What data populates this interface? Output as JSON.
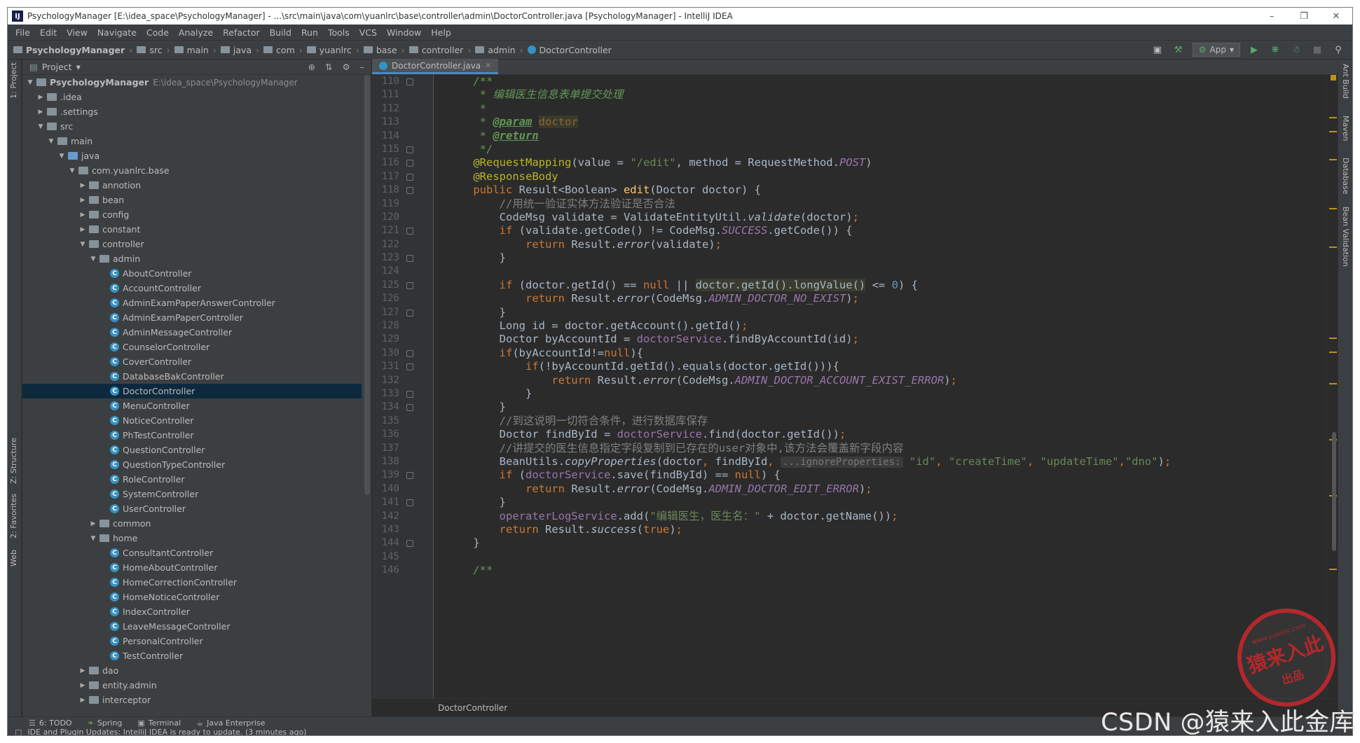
{
  "window": {
    "title": "PsychologyManager [E:\\idea_space\\PsychologyManager] - ...\\src\\main\\java\\com\\yuanlrc\\base\\controller\\admin\\DoctorController.java [PsychologyManager] - IntelliJ IDEA",
    "app_icon": "IJ",
    "controls": [
      "–",
      "❐",
      "✕"
    ]
  },
  "menu": [
    "File",
    "Edit",
    "View",
    "Navigate",
    "Code",
    "Analyze",
    "Refactor",
    "Build",
    "Run",
    "Tools",
    "VCS",
    "Window",
    "Help"
  ],
  "breadcrumbs": [
    "PsychologyManager",
    "src",
    "main",
    "java",
    "com",
    "yuanlrc",
    "base",
    "controller",
    "admin",
    "DoctorController"
  ],
  "run_config": "App",
  "project_panel": {
    "title": "Project",
    "tree": [
      {
        "label": "PsychologyManager",
        "path": "E:\\idea_space\\PsychologyManager",
        "depth": 0,
        "arrow": "down",
        "icon": "folder",
        "bold": true
      },
      {
        "label": ".idea",
        "depth": 1,
        "arrow": "right",
        "icon": "folder"
      },
      {
        "label": ".settings",
        "depth": 1,
        "arrow": "right",
        "icon": "folder"
      },
      {
        "label": "src",
        "depth": 1,
        "arrow": "down",
        "icon": "folder"
      },
      {
        "label": "main",
        "depth": 2,
        "arrow": "down",
        "icon": "folder"
      },
      {
        "label": "java",
        "depth": 3,
        "arrow": "down",
        "icon": "folder-blue"
      },
      {
        "label": "com.yuanlrc.base",
        "depth": 4,
        "arrow": "down",
        "icon": "folder"
      },
      {
        "label": "annotion",
        "depth": 5,
        "arrow": "right",
        "icon": "folder"
      },
      {
        "label": "bean",
        "depth": 5,
        "arrow": "right",
        "icon": "folder"
      },
      {
        "label": "config",
        "depth": 5,
        "arrow": "right",
        "icon": "folder"
      },
      {
        "label": "constant",
        "depth": 5,
        "arrow": "right",
        "icon": "folder"
      },
      {
        "label": "controller",
        "depth": 5,
        "arrow": "down",
        "icon": "folder"
      },
      {
        "label": "admin",
        "depth": 6,
        "arrow": "down",
        "icon": "folder"
      },
      {
        "label": "AboutController",
        "depth": 7,
        "icon": "class"
      },
      {
        "label": "AccountController",
        "depth": 7,
        "icon": "class"
      },
      {
        "label": "AdminExamPaperAnswerController",
        "depth": 7,
        "icon": "class"
      },
      {
        "label": "AdminExamPaperController",
        "depth": 7,
        "icon": "class"
      },
      {
        "label": "AdminMessageController",
        "depth": 7,
        "icon": "class"
      },
      {
        "label": "CounselorController",
        "depth": 7,
        "icon": "class"
      },
      {
        "label": "CoverController",
        "depth": 7,
        "icon": "class"
      },
      {
        "label": "DatabaseBakController",
        "depth": 7,
        "icon": "class"
      },
      {
        "label": "DoctorController",
        "depth": 7,
        "icon": "class",
        "selected": true
      },
      {
        "label": "MenuController",
        "depth": 7,
        "icon": "class"
      },
      {
        "label": "NoticeController",
        "depth": 7,
        "icon": "class"
      },
      {
        "label": "PhTestController",
        "depth": 7,
        "icon": "class"
      },
      {
        "label": "QuestionController",
        "depth": 7,
        "icon": "class"
      },
      {
        "label": "QuestionTypeController",
        "depth": 7,
        "icon": "class"
      },
      {
        "label": "RoleController",
        "depth": 7,
        "icon": "class"
      },
      {
        "label": "SystemController",
        "depth": 7,
        "icon": "class"
      },
      {
        "label": "UserController",
        "depth": 7,
        "icon": "class"
      },
      {
        "label": "common",
        "depth": 6,
        "arrow": "right",
        "icon": "folder"
      },
      {
        "label": "home",
        "depth": 6,
        "arrow": "down",
        "icon": "folder"
      },
      {
        "label": "ConsultantController",
        "depth": 7,
        "icon": "class"
      },
      {
        "label": "HomeAboutController",
        "depth": 7,
        "icon": "class"
      },
      {
        "label": "HomeCorrectionController",
        "depth": 7,
        "icon": "class"
      },
      {
        "label": "HomeNoticeController",
        "depth": 7,
        "icon": "class"
      },
      {
        "label": "IndexController",
        "depth": 7,
        "icon": "class"
      },
      {
        "label": "LeaveMessageController",
        "depth": 7,
        "icon": "class"
      },
      {
        "label": "PersonalController",
        "depth": 7,
        "icon": "class"
      },
      {
        "label": "TestController",
        "depth": 7,
        "icon": "class"
      },
      {
        "label": "dao",
        "depth": 5,
        "arrow": "right",
        "icon": "folder"
      },
      {
        "label": "entity.admin",
        "depth": 5,
        "arrow": "right",
        "icon": "folder"
      },
      {
        "label": "interceptor",
        "depth": 5,
        "arrow": "right",
        "icon": "folder"
      }
    ]
  },
  "editor": {
    "tab": "DoctorController.java",
    "breadcrumb": "DoctorController",
    "lines": [
      {
        "n": 110,
        "fold": true,
        "t": [
          [
            "doc",
            "    /**"
          ]
        ]
      },
      {
        "n": 111,
        "t": [
          [
            "doc",
            "     * 编辑医生信息表单提交处理"
          ]
        ]
      },
      {
        "n": 112,
        "t": [
          [
            "doc",
            "     *"
          ]
        ]
      },
      {
        "n": 113,
        "t": [
          [
            "doc",
            "     * "
          ],
          [
            "doctag",
            "@param"
          ],
          [
            "doc",
            " "
          ],
          [
            "docparam",
            "doctor"
          ]
        ]
      },
      {
        "n": 114,
        "t": [
          [
            "doc",
            "     * "
          ],
          [
            "doctag",
            "@return"
          ]
        ]
      },
      {
        "n": 115,
        "fold": true,
        "t": [
          [
            "doc",
            "     */"
          ]
        ]
      },
      {
        "n": 116,
        "fold": true,
        "t": [
          [
            "ann",
            "    @RequestMapping"
          ],
          [
            "",
            "(value = "
          ],
          [
            "str",
            "\"/edit\""
          ],
          [
            "",
            ", method = RequestMethod."
          ],
          [
            "cst",
            "POST"
          ],
          [
            "",
            ")"
          ]
        ]
      },
      {
        "n": 117,
        "fold": true,
        "t": [
          [
            "ann",
            "    @ResponseBody"
          ]
        ]
      },
      {
        "n": 118,
        "fold": true,
        "t": [
          [
            "kw",
            "    public "
          ],
          [
            "",
            "Result<Boolean> "
          ],
          [
            "fn",
            "edit"
          ],
          [
            "",
            "(Doctor doctor) {"
          ]
        ]
      },
      {
        "n": 119,
        "t": [
          [
            "cmt",
            "        //用统一验证实体方法验证是否合法"
          ]
        ]
      },
      {
        "n": 120,
        "t": [
          [
            "",
            "        CodeMsg validate = ValidateEntityUtil."
          ],
          [
            "it",
            "validate"
          ],
          [
            "",
            "(doctor)"
          ],
          [
            "kw",
            ";"
          ]
        ]
      },
      {
        "n": 121,
        "fold": true,
        "t": [
          [
            "kw",
            "        if "
          ],
          [
            "",
            "(validate.getCode() != CodeMsg."
          ],
          [
            "cst",
            "SUCCESS"
          ],
          [
            "",
            ".getCode()) {"
          ]
        ]
      },
      {
        "n": 122,
        "t": [
          [
            "kw",
            "            return "
          ],
          [
            "",
            "Result."
          ],
          [
            "it",
            "error"
          ],
          [
            "",
            "(validate)"
          ],
          [
            "kw",
            ";"
          ]
        ]
      },
      {
        "n": 123,
        "fold": true,
        "t": [
          [
            "",
            "        }"
          ]
        ]
      },
      {
        "n": 124,
        "t": [
          [
            "",
            ""
          ]
        ]
      },
      {
        "n": 125,
        "fold": true,
        "t": [
          [
            "kw",
            "        if "
          ],
          [
            "",
            "(doctor.getId() == "
          ],
          [
            "kw",
            "null"
          ],
          [
            "",
            " || "
          ],
          [
            "hl",
            "doctor.getId().longValue()"
          ],
          [
            "",
            " <= "
          ],
          [
            "num",
            "0"
          ],
          [
            "",
            ") {"
          ]
        ]
      },
      {
        "n": 126,
        "t": [
          [
            "kw",
            "            return "
          ],
          [
            "",
            "Result."
          ],
          [
            "it",
            "error"
          ],
          [
            "",
            "(CodeMsg."
          ],
          [
            "cst",
            "ADMIN_DOCTOR_NO_EXIST"
          ],
          [
            "",
            ")"
          ],
          [
            "kw",
            ";"
          ]
        ]
      },
      {
        "n": 127,
        "fold": true,
        "t": [
          [
            "",
            "        }"
          ]
        ]
      },
      {
        "n": 128,
        "t": [
          [
            "",
            "        Long id = doctor.getAccount().getId()"
          ],
          [
            "kw",
            ";"
          ]
        ]
      },
      {
        "n": 129,
        "t": [
          [
            "",
            "        Doctor byAccountId = "
          ],
          [
            "fld",
            "doctorService"
          ],
          [
            "",
            ".findByAccountId(id)"
          ],
          [
            "kw",
            ";"
          ]
        ]
      },
      {
        "n": 130,
        "fold": true,
        "t": [
          [
            "kw",
            "        if"
          ],
          [
            "",
            "(byAccountId!="
          ],
          [
            "kw",
            "null"
          ],
          [
            "",
            "){"
          ]
        ]
      },
      {
        "n": 131,
        "fold": true,
        "t": [
          [
            "kw",
            "            if"
          ],
          [
            "",
            "(!byAccountId.getId().equals(doctor.getId())){"
          ]
        ]
      },
      {
        "n": 132,
        "t": [
          [
            "kw",
            "                return "
          ],
          [
            "",
            "Result."
          ],
          [
            "it",
            "error"
          ],
          [
            "",
            "(CodeMsg."
          ],
          [
            "cst",
            "ADMIN_DOCTOR_ACCOUNT_EXIST_ERROR"
          ],
          [
            "",
            ")"
          ],
          [
            "kw",
            ";"
          ]
        ]
      },
      {
        "n": 133,
        "fold": true,
        "t": [
          [
            "",
            "            }"
          ]
        ]
      },
      {
        "n": 134,
        "fold": true,
        "t": [
          [
            "",
            "        }"
          ]
        ]
      },
      {
        "n": 135,
        "t": [
          [
            "cmt",
            "        //到这说明一切符合条件，进行数据库保存"
          ]
        ]
      },
      {
        "n": 136,
        "t": [
          [
            "",
            "        Doctor findById = "
          ],
          [
            "fld",
            "doctorService"
          ],
          [
            "",
            ".find(doctor.getId())"
          ],
          [
            "kw",
            ";"
          ]
        ]
      },
      {
        "n": 137,
        "t": [
          [
            "cmt",
            "        //讲提交的医生信息指定字段复制到已存在的user对象中,该方法会覆盖新字段内容"
          ]
        ]
      },
      {
        "n": 138,
        "t": [
          [
            "",
            "        BeanUtils."
          ],
          [
            "it",
            "copyProperties"
          ],
          [
            "",
            "(doctor"
          ],
          [
            "kw",
            ", "
          ],
          [
            "",
            "findById"
          ],
          [
            "kw",
            ", "
          ],
          [
            "hint",
            "...ignoreProperties:"
          ],
          [
            "",
            " "
          ],
          [
            "str",
            "\"id\""
          ],
          [
            "kw",
            ", "
          ],
          [
            "str",
            "\"createTime\""
          ],
          [
            "kw",
            ", "
          ],
          [
            "str",
            "\"updateTime\""
          ],
          [
            "kw",
            ","
          ],
          [
            "str",
            "\"dno\""
          ],
          [
            "",
            ")"
          ],
          [
            "kw",
            ";"
          ]
        ]
      },
      {
        "n": 139,
        "fold": true,
        "t": [
          [
            "kw",
            "        if "
          ],
          [
            "",
            "("
          ],
          [
            "fld",
            "doctorService"
          ],
          [
            "",
            ".save(findById) == "
          ],
          [
            "kw",
            "null"
          ],
          [
            "",
            ") {"
          ]
        ]
      },
      {
        "n": 140,
        "t": [
          [
            "kw",
            "            return "
          ],
          [
            "",
            "Result."
          ],
          [
            "it",
            "error"
          ],
          [
            "",
            "(CodeMsg."
          ],
          [
            "cst",
            "ADMIN_DOCTOR_EDIT_ERROR"
          ],
          [
            "",
            ")"
          ],
          [
            "kw",
            ";"
          ]
        ]
      },
      {
        "n": 141,
        "fold": true,
        "t": [
          [
            "",
            "        }"
          ]
        ]
      },
      {
        "n": 142,
        "t": [
          [
            "fld",
            "        operaterLogService"
          ],
          [
            "",
            ".add("
          ],
          [
            "str",
            "\"编辑医生，医生名：\""
          ],
          [
            "",
            " + doctor.getName())"
          ],
          [
            "kw",
            ";"
          ]
        ]
      },
      {
        "n": 143,
        "t": [
          [
            "kw",
            "        return "
          ],
          [
            "",
            "Result."
          ],
          [
            "it",
            "success"
          ],
          [
            "",
            "("
          ],
          [
            "kw",
            "true"
          ],
          [
            "",
            ")"
          ],
          [
            "kw",
            ";"
          ]
        ]
      },
      {
        "n": 144,
        "fold": true,
        "t": [
          [
            "",
            "    }"
          ]
        ]
      },
      {
        "n": 145,
        "t": [
          [
            "",
            ""
          ]
        ]
      },
      {
        "n": 146,
        "t": [
          [
            "doc",
            "    /**"
          ]
        ]
      }
    ]
  },
  "left_tabs": [
    "1: Project",
    "Z: Structure",
    "2: Favorites",
    "Web"
  ],
  "right_tabs": [
    "Ant Build",
    "Maven",
    "Database",
    "Bean Validation"
  ],
  "bottom_tabs": [
    {
      "label": "6: TODO",
      "icon": "☰"
    },
    {
      "label": "Spring",
      "icon": "❧"
    },
    {
      "label": "Terminal",
      "icon": "▣"
    },
    {
      "label": "Java Enterprise",
      "icon": "☕"
    }
  ],
  "status": "IDE and Plugin Updates: IntelliJ IDEA is ready to update. (3 minutes ago)",
  "watermark": {
    "stamp_top": "www.yuanlrc.com",
    "stamp_main": "猿来入此",
    "stamp_sub": "出品",
    "csdn": "CSDN @猿来入此金库"
  }
}
